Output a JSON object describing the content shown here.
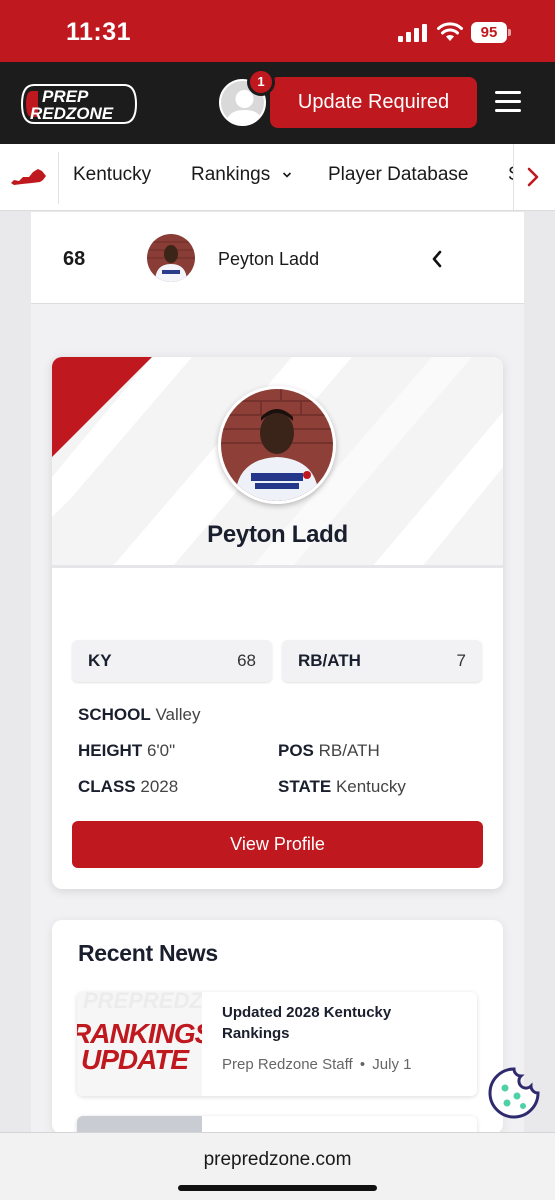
{
  "status_bar": {
    "time": "11:31",
    "battery": "95"
  },
  "header": {
    "logo_line1": "PREP",
    "logo_line2": "REDZONE",
    "notification_count": "1",
    "update_button": "Update Required"
  },
  "nav": {
    "items": [
      {
        "label": "Kentucky"
      },
      {
        "label": "Rankings"
      },
      {
        "label": "Player Database"
      }
    ],
    "overflow_label": "S"
  },
  "player_strip": {
    "rank": "68",
    "name": "Peyton Ladd"
  },
  "player_card": {
    "name": "Peyton Ladd",
    "stats": [
      {
        "label": "KY",
        "value": "68"
      },
      {
        "label": "RB/ATH",
        "value": "7"
      }
    ],
    "school_label": "SCHOOL",
    "school": "Valley",
    "height_label": "HEIGHT",
    "height": "6'0\"",
    "pos_label": "POS",
    "pos": "RB/ATH",
    "class_label": "CLASS",
    "class": "2028",
    "state_label": "STATE",
    "state": "Kentucky",
    "view_button": "View Profile"
  },
  "recent_news": {
    "title": "Recent News",
    "items": [
      {
        "thumb_line1": "RANKINGS",
        "thumb_line2": "UPDATE",
        "headline": "Updated 2028 Kentucky Rankings",
        "author": "Prep Redzone Staff",
        "separator": "•",
        "date": "July 1"
      }
    ]
  },
  "browser": {
    "url": "prepredzone.com"
  },
  "colors": {
    "brand_red": "#c0181f",
    "header_dark": "#1c1c1c",
    "text_dark": "#1a1f2e"
  }
}
